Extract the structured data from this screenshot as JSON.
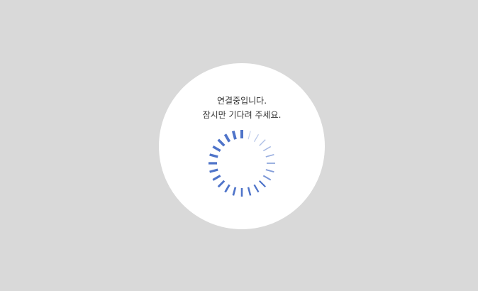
{
  "dialog": {
    "message_line1": "연결중입니다.",
    "message_line2": "잠시만 기다려 주세요."
  },
  "spinner": {
    "icon": "loading-spinner-icon",
    "segments": 24,
    "filled_segments": 16,
    "start_segment": 0
  },
  "colors": {
    "background": "#d9d9d9",
    "circle": "#ffffff",
    "spinner": "#4f74c9",
    "text": "#333333"
  }
}
